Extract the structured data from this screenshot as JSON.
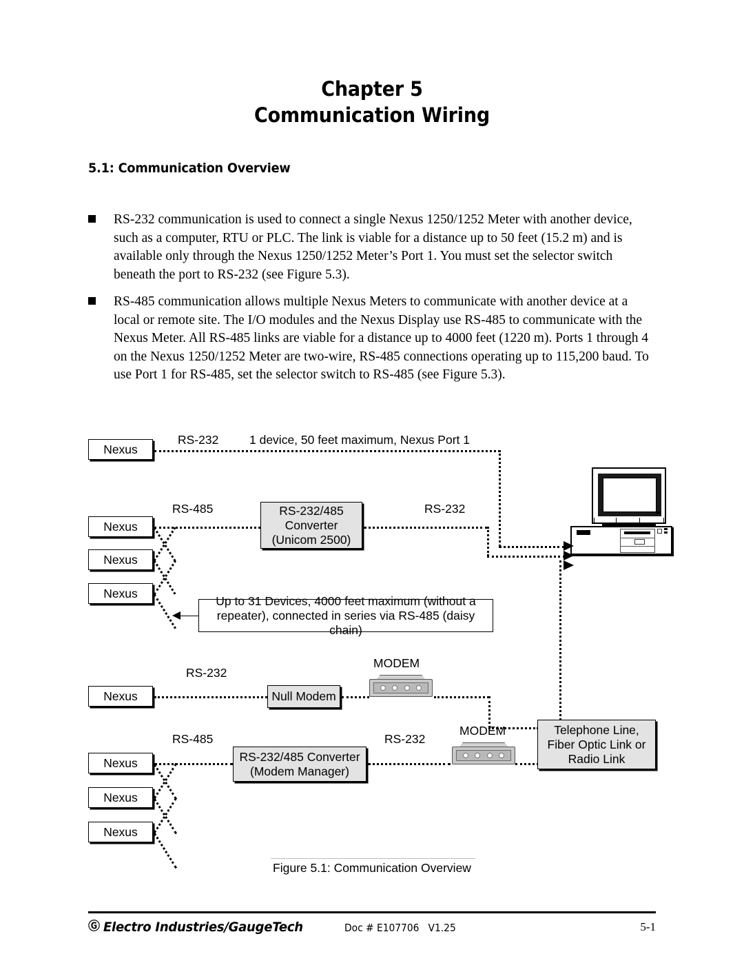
{
  "document": {
    "chapter_label": "Chapter 5",
    "chapter_title": "Communication Wiring",
    "section_title": "5.1: Communication Overview",
    "bullets": [
      "RS-232 communication is used to connect a single Nexus 1250/1252 Meter with another device, such as a computer, RTU or PLC. The link is viable for a distance up to 50 feet (15.2 m) and is available only through the Nexus 1250/1252 Meter’s Port 1. You must set the selector switch beneath the port to RS-232 (see Figure 5.3).",
      "RS-485 communication allows multiple Nexus Meters to communicate with another device at a local or remote site. The I/O modules and the Nexus Display use RS-485 to communicate with the Nexus Meter.  All RS-485 links are viable for a distance up to 4000 feet (1220 m). Ports 1 through 4 on the Nexus 1250/1252 Meter are two-wire, RS-485 connections operating up to 115,200 baud. To use Port 1 for RS-485, set the selector switch to RS-485 (see Figure 5.3)."
    ]
  },
  "figure": {
    "caption": "Figure 5.1: Communication Overview",
    "nodes": {
      "nexus": "Nexus",
      "converter_unicom_line1": "RS-232/485",
      "converter_unicom_line2": "Converter",
      "converter_unicom_line3": "(Unicom 2500)",
      "null_modem": "Null Modem",
      "converter_modem_line1": "RS-232/485 Converter",
      "converter_modem_line2": "(Modem Manager)",
      "link_line1": "Telephone Line,",
      "link_line2": "Fiber Optic Link or",
      "link_line3": "Radio Link",
      "modem": "MODEM"
    },
    "labels": {
      "rs232_top": "RS-232",
      "top_note": "1 device, 50 feet maximum, Nexus Port 1",
      "rs485_upper": "RS-485",
      "rs232_upper_right": "RS-232",
      "daisy_note_line1": "Up to 31 Devices, 4000 feet maximum (without a",
      "daisy_note_line2": "repeater), connected in series via RS-485 (daisy chain)",
      "rs232_modem": "RS-232",
      "rs485_lower": "RS-485",
      "rs232_lower_right": "RS-232"
    }
  },
  "footer": {
    "logo_glyph": "Ⓖ",
    "company": "Electro Industries/GaugeTech",
    "doc": "Doc # E107706   V1.25",
    "page": "5-1"
  }
}
